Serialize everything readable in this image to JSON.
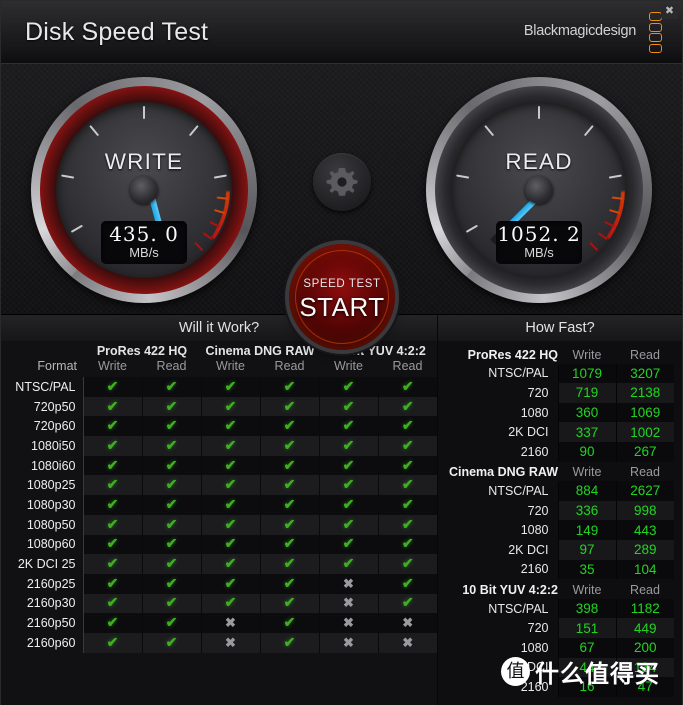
{
  "window": {
    "title": "Disk Speed Test",
    "brand": "Blackmagicdesign",
    "close_label": "✖",
    "accent_orange": "#f08c18"
  },
  "meters": {
    "write": {
      "label": "WRITE",
      "value": "435. 0",
      "unit": "MB/s",
      "needle_deg": 255,
      "needle_color": "#1aa8e8",
      "ring_color": "#8e1313"
    },
    "read": {
      "label": "READ",
      "value": "1052. 2",
      "unit": "MB/s",
      "needle_deg": 315,
      "needle_color": "#1aa8e8",
      "ring_color": "#55555a"
    },
    "gear_icon": "gear-icon",
    "start": {
      "sub_label": "SPEED TEST",
      "main_label": "START",
      "color": "#8e0d0d"
    }
  },
  "sections": {
    "will_it_work": "Will it Work?",
    "how_fast": "How Fast?"
  },
  "will_it_work": {
    "codecs": [
      "ProRes 422 HQ",
      "Cinema DNG RAW",
      "10 Bit YUV 4:2:2"
    ],
    "format_header": "Format",
    "sub_headers": [
      "Write",
      "Read",
      "Write",
      "Read",
      "Write",
      "Read"
    ],
    "ok_glyph": "✔",
    "no_glyph": "✖",
    "rows": [
      {
        "format": "NTSC/PAL",
        "cells": [
          "ok",
          "ok",
          "ok",
          "ok",
          "ok",
          "ok"
        ]
      },
      {
        "format": "720p50",
        "cells": [
          "ok",
          "ok",
          "ok",
          "ok",
          "ok",
          "ok"
        ]
      },
      {
        "format": "720p60",
        "cells": [
          "ok",
          "ok",
          "ok",
          "ok",
          "ok",
          "ok"
        ]
      },
      {
        "format": "1080i50",
        "cells": [
          "ok",
          "ok",
          "ok",
          "ok",
          "ok",
          "ok"
        ]
      },
      {
        "format": "1080i60",
        "cells": [
          "ok",
          "ok",
          "ok",
          "ok",
          "ok",
          "ok"
        ]
      },
      {
        "format": "1080p25",
        "cells": [
          "ok",
          "ok",
          "ok",
          "ok",
          "ok",
          "ok"
        ]
      },
      {
        "format": "1080p30",
        "cells": [
          "ok",
          "ok",
          "ok",
          "ok",
          "ok",
          "ok"
        ]
      },
      {
        "format": "1080p50",
        "cells": [
          "ok",
          "ok",
          "ok",
          "ok",
          "ok",
          "ok"
        ]
      },
      {
        "format": "1080p60",
        "cells": [
          "ok",
          "ok",
          "ok",
          "ok",
          "ok",
          "ok"
        ]
      },
      {
        "format": "2K DCI 25",
        "cells": [
          "ok",
          "ok",
          "ok",
          "ok",
          "ok",
          "ok"
        ]
      },
      {
        "format": "2160p25",
        "cells": [
          "ok",
          "ok",
          "ok",
          "ok",
          "no",
          "ok"
        ]
      },
      {
        "format": "2160p30",
        "cells": [
          "ok",
          "ok",
          "ok",
          "ok",
          "no",
          "ok"
        ]
      },
      {
        "format": "2160p50",
        "cells": [
          "ok",
          "ok",
          "no",
          "ok",
          "no",
          "no"
        ]
      },
      {
        "format": "2160p60",
        "cells": [
          "ok",
          "ok",
          "no",
          "ok",
          "no",
          "no"
        ]
      }
    ]
  },
  "how_fast": {
    "col_write": "Write",
    "col_read": "Read",
    "groups": [
      {
        "name": "ProRes 422 HQ",
        "rows": [
          {
            "res": "NTSC/PAL",
            "write": "1079",
            "read": "3207"
          },
          {
            "res": "720",
            "write": "719",
            "read": "2138"
          },
          {
            "res": "1080",
            "write": "360",
            "read": "1069"
          },
          {
            "res": "2K DCI",
            "write": "337",
            "read": "1002"
          },
          {
            "res": "2160",
            "write": "90",
            "read": "267"
          }
        ]
      },
      {
        "name": "Cinema DNG RAW",
        "rows": [
          {
            "res": "NTSC/PAL",
            "write": "884",
            "read": "2627"
          },
          {
            "res": "720",
            "write": "336",
            "read": "998"
          },
          {
            "res": "1080",
            "write": "149",
            "read": "443"
          },
          {
            "res": "2K DCI",
            "write": "97",
            "read": "289"
          },
          {
            "res": "2160",
            "write": "35",
            "read": "104"
          }
        ]
      },
      {
        "name": "10 Bit YUV 4:2:2",
        "rows": [
          {
            "res": "NTSC/PAL",
            "write": "398",
            "read": "1182"
          },
          {
            "res": "720",
            "write": "151",
            "read": "449"
          },
          {
            "res": "1080",
            "write": "67",
            "read": "200"
          },
          {
            "res": "2K DCI",
            "write": "44",
            "read": "134"
          },
          {
            "res": "2160",
            "write": "16",
            "read": "47"
          }
        ]
      }
    ]
  },
  "watermark": {
    "seal": "值",
    "text": "什么值得买"
  }
}
